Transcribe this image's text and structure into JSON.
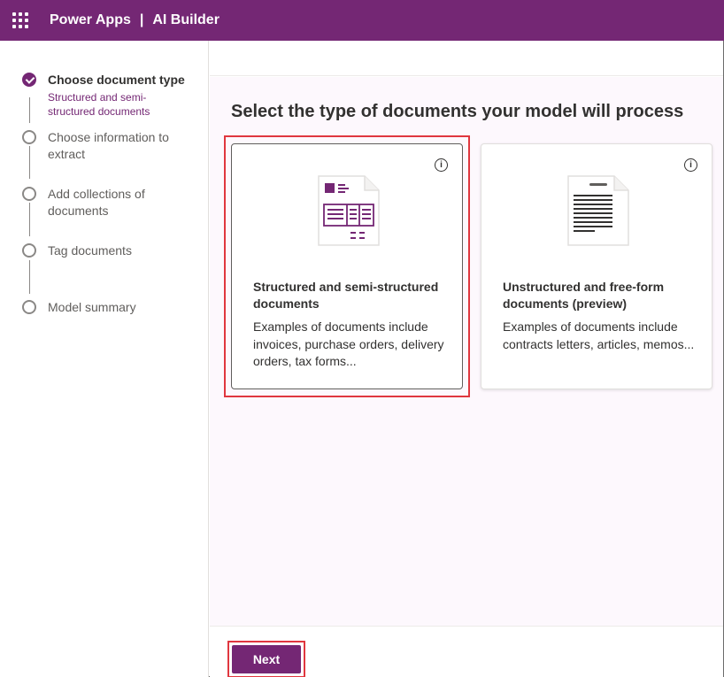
{
  "header": {
    "app_name": "Power Apps",
    "separator": "|",
    "product": "AI Builder",
    "brand_color": "#742774"
  },
  "steps": [
    {
      "label": "Choose document type",
      "sublabel": "Structured and semi-structured documents",
      "status": "done"
    },
    {
      "label": "Choose information to extract",
      "status": "pending"
    },
    {
      "label": "Add collections of documents",
      "status": "pending"
    },
    {
      "label": "Tag documents",
      "status": "pending"
    },
    {
      "label": "Model summary",
      "status": "pending"
    }
  ],
  "main": {
    "heading": "Select the type of documents your model will process",
    "cards": [
      {
        "title": "Structured and semi-structured documents",
        "description": "Examples of documents include invoices, purchase orders, delivery orders, tax forms...",
        "info_icon": "info-icon",
        "selected": true
      },
      {
        "title": "Unstructured and free-form documents (preview)",
        "description": "Examples of documents include contracts letters, articles, memos...",
        "info_icon": "info-icon",
        "selected": false
      }
    ]
  },
  "footer": {
    "next_label": "Next"
  },
  "colors": {
    "highlight": "#e0373f",
    "accent": "#742774"
  }
}
